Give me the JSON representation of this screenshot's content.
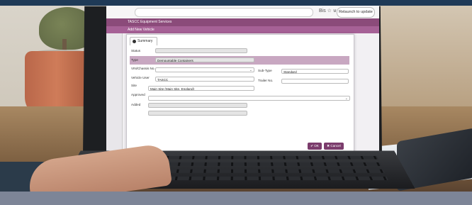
{
  "browser": {
    "toolbar_icons": "Bis ☆ ⊍ ⬒",
    "relaunch_label": "Relaunch to update ⋮"
  },
  "app": {
    "title": "TASCC Equipment Services",
    "page_title": "Add New Vehicle"
  },
  "dialog": {
    "tab_label": "Summary",
    "fields": {
      "status_label": "Status",
      "type_label": "Type",
      "type_value": "Demountable Containers",
      "vin_label": "VIN/Chassis No.",
      "subtype_label": "Sub-Type",
      "subtype_value": "Standard",
      "vehicle_use_label": "Vehicle User",
      "vehicle_use_value": "TASCC",
      "trailer_label": "Trailer No.",
      "site_label": "Site",
      "site_value": "Main Site (Main Site, England)",
      "approved_label": "Approved",
      "added_label": "Added"
    },
    "ok_label": "✔ OK",
    "cancel_label": "✖ Cancel"
  },
  "colors": {
    "header": "#8b4b7a",
    "band": "#c8a7c1",
    "button": "#7b3c6c",
    "bottom_bar": "#7d8597",
    "top_stripe": "#1f3a57"
  }
}
